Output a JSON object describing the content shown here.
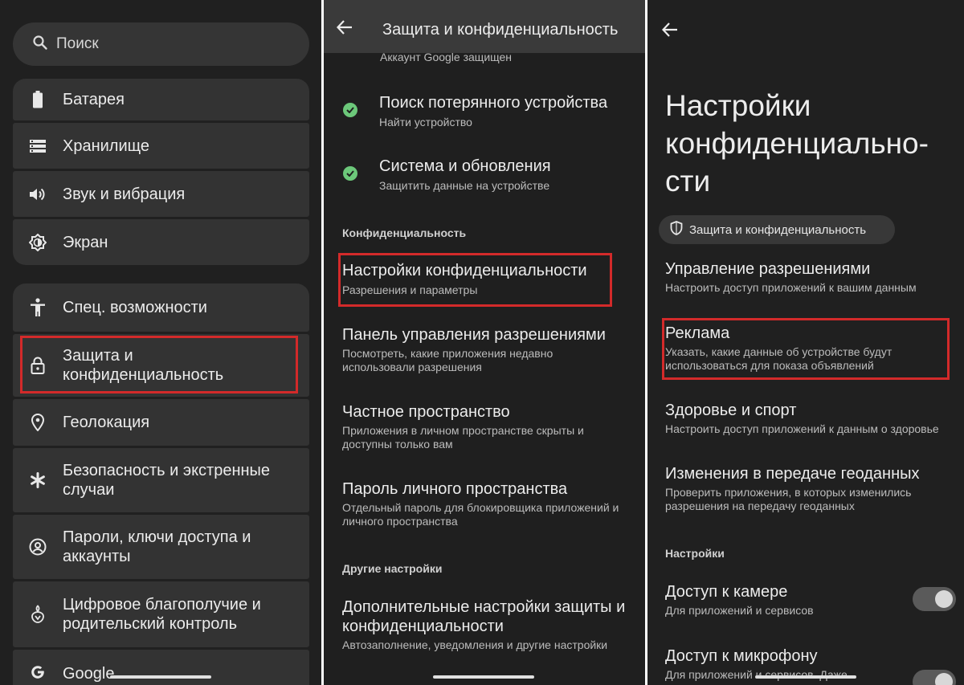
{
  "panel1": {
    "search": {
      "icon": "search-icon",
      "placeholder": "Поиск"
    },
    "items": [
      {
        "label": "Батарея",
        "icon": "battery-icon"
      },
      {
        "label": "Хранилище",
        "icon": "storage-icon"
      },
      {
        "label": "Звук и вибрация",
        "icon": "volume-icon"
      },
      {
        "label": "Экран",
        "icon": "brightness-icon"
      },
      {
        "label": "Спец. возможности",
        "icon": "accessibility-icon"
      },
      {
        "label": "Защита и конфиденциальность",
        "icon": "lock-icon",
        "highlighted": true
      },
      {
        "label": "Геолокация",
        "icon": "location-pin-icon"
      },
      {
        "label": "Безопасность и экстренные случаи",
        "icon": "asterisk-icon"
      },
      {
        "label": "Пароли, ключи доступа и аккаунты",
        "icon": "account-circle-icon"
      },
      {
        "label": "Цифровое благополучие и родительский контроль",
        "icon": "wellbeing-icon"
      },
      {
        "label": "Google",
        "icon": "google-icon"
      }
    ]
  },
  "panel2": {
    "title": "Защита и конфиденциальность",
    "top_subtitle": "Аккаунт Google защищен",
    "security_items": [
      {
        "title": "Поиск потерянного устройства",
        "subtitle": "Найти устройство",
        "status": "ok"
      },
      {
        "title": "Система и обновления",
        "subtitle": "Защитить данные на устройстве",
        "status": "ok"
      }
    ],
    "section_privacy": "Конфиденциальность",
    "privacy_items": [
      {
        "title": "Настройки конфиденциальности",
        "subtitle": "Разрешения и параметры",
        "highlighted": true
      },
      {
        "title": "Панель управления разрешениями",
        "subtitle": "Посмотреть, какие приложения недавно использовали разрешения"
      },
      {
        "title": "Частное пространство",
        "subtitle": "Приложения в личном пространстве скрыты и доступны только вам"
      },
      {
        "title": "Пароль личного пространства",
        "subtitle": "Отдельный пароль для блокировщика приложений и личного пространства"
      }
    ],
    "section_other": "Другие настройки",
    "other_items": [
      {
        "title": "Дополнительные настройки защиты и конфиденциальности",
        "subtitle": "Автозаполнение, уведомления и другие настройки"
      }
    ]
  },
  "panel3": {
    "title": "Настройки конфиденциально-сти",
    "chip_label": "Защита и конфиденциальность",
    "items": [
      {
        "title": "Управление разрешениями",
        "subtitle": "Настроить доступ приложений к вашим данным"
      },
      {
        "title": "Реклама",
        "subtitle": "Указать, какие данные об устройстве будут использоваться для показа объявлений",
        "highlighted": true
      },
      {
        "title": "Здоровье и спорт",
        "subtitle": "Настроить доступ приложений к данным о здоровье"
      },
      {
        "title": "Изменения в передаче геоданных",
        "subtitle": "Проверить приложения, в которых изменились разрешения на передачу геоданных"
      }
    ],
    "section_settings": "Настройки",
    "toggles": [
      {
        "title": "Доступ к камере",
        "subtitle": "Для приложений и сервисов",
        "on": true
      },
      {
        "title": "Доступ к микрофону",
        "subtitle": "Для приложений и сервисов. Даже",
        "on": true
      }
    ]
  },
  "colors": {
    "background": "#202020",
    "card": "#333333",
    "highlight_border": "#d32a2a",
    "check_green": "#6cc87a"
  }
}
